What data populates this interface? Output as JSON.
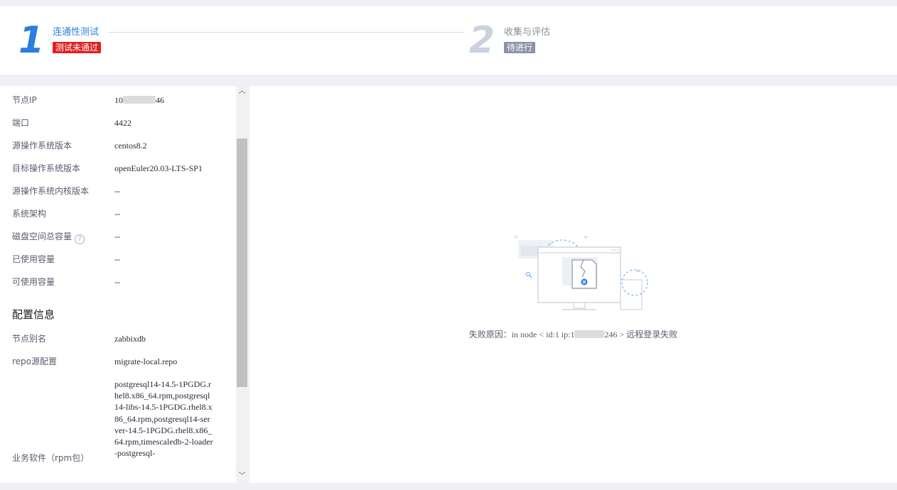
{
  "stepper": {
    "steps": [
      {
        "number": "1",
        "title": "连通性测试",
        "status": "测试未通过",
        "state": "failed"
      },
      {
        "number": "2",
        "title": "收集与评估",
        "status": "待进行",
        "state": "pending"
      }
    ]
  },
  "node_info": {
    "rows": [
      {
        "label": "节点IP",
        "value_prefix": "10",
        "value_suffix": "46"
      },
      {
        "label": "端口",
        "value": "4422"
      },
      {
        "label": "源操作系统版本",
        "value": "centos8.2"
      },
      {
        "label": "目标操作系统版本",
        "value": "openEuler20.03-LTS-SP1"
      },
      {
        "label": "源操作系统内核版本",
        "value": "--"
      },
      {
        "label": "系统架构",
        "value": "--"
      },
      {
        "label": "磁盘空间总容量",
        "value": "--"
      },
      {
        "label": "已使用容量",
        "value": "--"
      },
      {
        "label": "可使用容量",
        "value": "--"
      }
    ]
  },
  "config_info": {
    "title": "配置信息",
    "rows": [
      {
        "label": "节点别名",
        "value": "zabbixdb"
      },
      {
        "label": "repo源配置",
        "value": "migrate-local.repo"
      },
      {
        "label": "业务软件（rpm包）",
        "value": "postgresql14-14.5-1PGDG.rhel8.x86_64.rpm,postgresql14-libs-14.5-1PGDG.rhel8.x86_64.rpm,postgresql14-server-14.5-1PGDG.rhel8.x86_64.rpm,timescaledb-2-loader-postgresql-"
      }
    ]
  },
  "result": {
    "label": "失败原因：",
    "message_prefix": "in node < id:1 ip:1",
    "message_suffix": "246 > ",
    "message_tail": "远程登录失败"
  },
  "colors": {
    "accent": "#2a7de1",
    "fail": "#e02020",
    "pending": "#8a93a6"
  },
  "icons": {
    "help": "question-circle-icon",
    "scroll_up": "chevron-up-icon",
    "scroll_down": "chevron-down-icon"
  }
}
